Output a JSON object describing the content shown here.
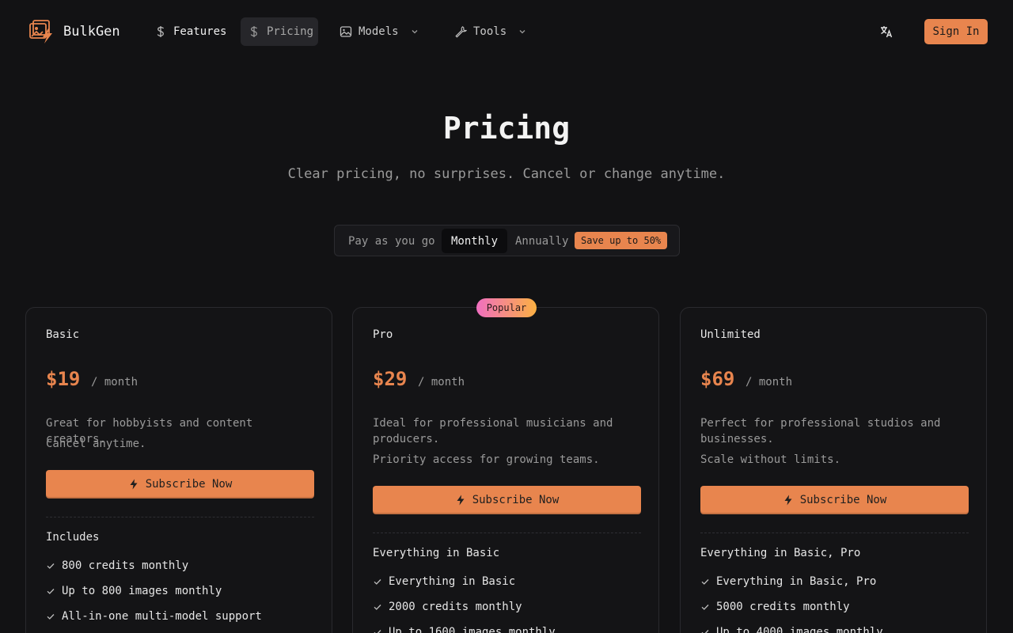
{
  "nav": {
    "brand": "BulkGen",
    "items": [
      {
        "label": "Features",
        "icon": "dollar-icon"
      },
      {
        "label": "Pricing",
        "icon": "dollar-icon"
      },
      {
        "label": "Models",
        "icon": "image-icon"
      },
      {
        "label": "Tools",
        "icon": "wrench-icon"
      }
    ],
    "sign_in": "Sign In"
  },
  "hero": {
    "title": "Pricing",
    "subtitle": "Clear pricing, no surprises. Cancel or change anytime."
  },
  "billing": {
    "options": [
      "Pay as you go",
      "Monthly",
      "Annually"
    ],
    "selected": "Monthly",
    "save_badge": "Save up to 50%"
  },
  "popular_badge": "Popular",
  "plans": [
    {
      "name": "Basic",
      "price": "$19",
      "period": "/ month",
      "description": "Great for hobbyists and content creators.",
      "note": "Cancel anytime.",
      "cta": "Subscribe Now",
      "includes_title": "Includes",
      "features": [
        "800 credits monthly",
        "Up to 800 images monthly",
        "All-in-one multi-model support"
      ]
    },
    {
      "name": "Pro",
      "price": "$29",
      "period": "/ month",
      "description": "Ideal for professional musicians and producers.",
      "note": "Priority access for growing teams.",
      "cta": "Subscribe Now",
      "includes_title": "Everything in Basic",
      "features": [
        "Everything in Basic",
        "2000 credits monthly",
        "Up to 1600 images monthly"
      ]
    },
    {
      "name": "Unlimited",
      "price": "$69",
      "period": "/ month",
      "description": "Perfect for professional studios and businesses.",
      "note": "Scale without limits.",
      "cta": "Subscribe Now",
      "includes_title": "Everything in Basic, Pro",
      "features": [
        "Everything in Basic, Pro",
        "5000 credits monthly",
        "Up to 4000 images monthly"
      ]
    }
  ],
  "colors": {
    "accent": "#e8854e",
    "background": "#121214",
    "card": "#141416"
  }
}
